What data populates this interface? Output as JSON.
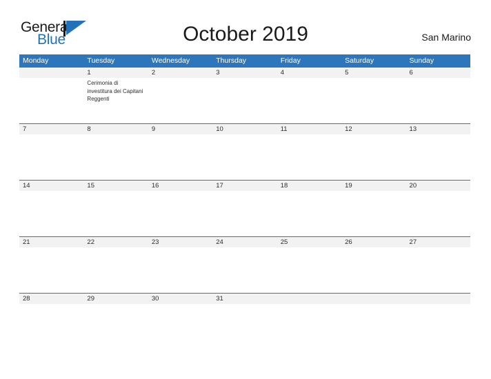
{
  "brand": {
    "name_part1": "General",
    "name_part2": "Blue",
    "flag_icon": "flag-triangle-icon",
    "color_black": "#1a1a1a",
    "color_blue": "#2272b9"
  },
  "header": {
    "title": "October 2019",
    "country": "San Marino"
  },
  "theme": {
    "header_band": "#2e76bb",
    "date_band": "#f2f2f2",
    "row_divider": "#2e76bb",
    "text": "#2b2b2b"
  },
  "calendar": {
    "weekdays": [
      "Monday",
      "Tuesday",
      "Wednesday",
      "Thursday",
      "Friday",
      "Saturday",
      "Sunday"
    ],
    "weeks": [
      {
        "dates": [
          "",
          "1",
          "2",
          "3",
          "4",
          "5",
          "6"
        ],
        "events": [
          "",
          "Cerimonia di investitura dei Capitani Reggenti",
          "",
          "",
          "",
          "",
          ""
        ]
      },
      {
        "dates": [
          "7",
          "8",
          "9",
          "10",
          "11",
          "12",
          "13"
        ],
        "events": [
          "",
          "",
          "",
          "",
          "",
          "",
          ""
        ]
      },
      {
        "dates": [
          "14",
          "15",
          "16",
          "17",
          "18",
          "19",
          "20"
        ],
        "events": [
          "",
          "",
          "",
          "",
          "",
          "",
          ""
        ]
      },
      {
        "dates": [
          "21",
          "22",
          "23",
          "24",
          "25",
          "26",
          "27"
        ],
        "events": [
          "",
          "",
          "",
          "",
          "",
          "",
          ""
        ]
      },
      {
        "dates": [
          "28",
          "29",
          "30",
          "31",
          "",
          "",
          ""
        ],
        "events": [
          "",
          "",
          "",
          "",
          "",
          "",
          ""
        ]
      }
    ]
  }
}
